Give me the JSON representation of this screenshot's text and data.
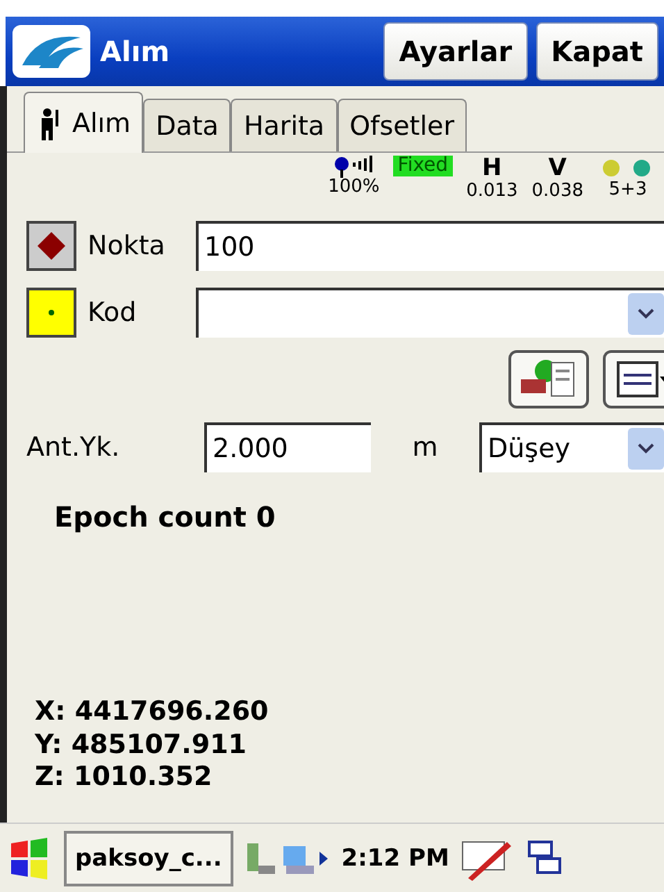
{
  "window": {
    "title": "Alım",
    "buttons": [
      "Ayarlar",
      "Kapat"
    ]
  },
  "tabs": [
    {
      "label": "Alım",
      "selected": true,
      "icon": true
    },
    {
      "label": "Data",
      "selected": false
    },
    {
      "label": "Harita",
      "selected": false
    },
    {
      "label": "Ofsetler",
      "selected": false
    }
  ],
  "status": {
    "signal": "100%",
    "solution": "Fixed",
    "h_label": "H",
    "h_value": "0.013",
    "v_label": "V",
    "v_value": "0.038",
    "satellites": "5+3"
  },
  "point": {
    "label": "Nokta",
    "value": "100"
  },
  "code": {
    "label": "Kod"
  },
  "antenna": {
    "label": "Ant.Yk.",
    "value": "2.000",
    "unit": "m",
    "method": "Düşey"
  },
  "epoch": "Epoch count 0",
  "coordinates": [
    "X: 4417696.260",
    "Y: 485107.911",
    "Z: 1010.352"
  ],
  "taskbar": {
    "task": "paksoy_c...",
    "time": "2:12 PM"
  }
}
